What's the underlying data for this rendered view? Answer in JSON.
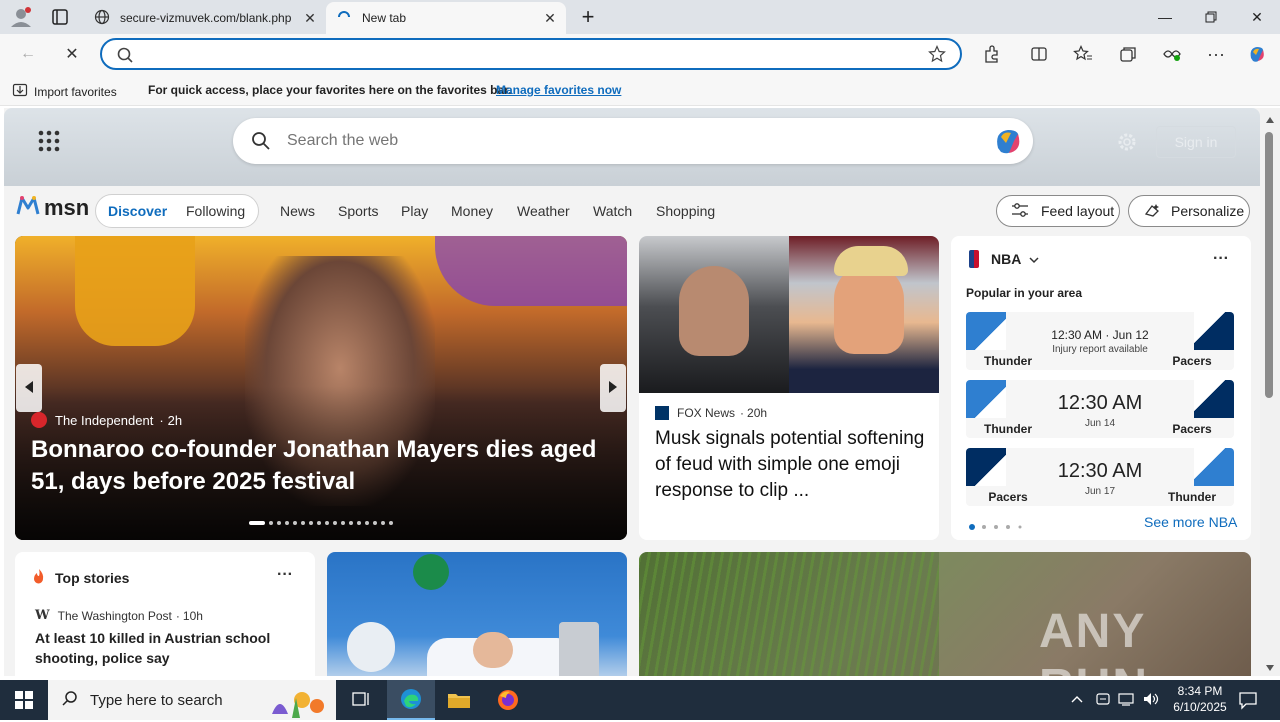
{
  "browser": {
    "tabs": [
      {
        "label": "secure-vizmuvek.com/blank.php",
        "active": false
      },
      {
        "label": "New tab",
        "active": true
      }
    ],
    "address": {
      "value": "",
      "placeholder": ""
    },
    "favorites_bar": {
      "import_label": "Import favorites",
      "message": "For quick access, place your favorites here on the favorites bar.",
      "manage_link": "Manage favorites now"
    }
  },
  "msn": {
    "search_placeholder": "Search the web",
    "signin_label": "Sign in",
    "logo_text": "msn",
    "discover_label": "Discover",
    "following_label": "Following",
    "nav": [
      "News",
      "Sports",
      "Play",
      "Money",
      "Weather",
      "Watch",
      "Shopping"
    ],
    "feed_layout_label": "Feed layout",
    "personalize_label": "Personalize"
  },
  "hero": {
    "source": "The Independent",
    "age": "2h",
    "headline": "Bonnaroo co-founder Jonathan Mayers dies aged 51, days before 2025 festival"
  },
  "story2": {
    "source": "FOX News",
    "age": "20h",
    "headline": "Musk signals potential softening of feud with simple one emoji response to clip ..."
  },
  "nba": {
    "title": "NBA",
    "subtitle": "Popular in your area",
    "games": [
      {
        "home": "Thunder",
        "away": "Pacers",
        "time": "12:30 AM · Jun 12",
        "note": "Injury report available"
      },
      {
        "home": "Thunder",
        "away": "Pacers",
        "time": "12:30 AM",
        "note": "Jun 14"
      },
      {
        "home": "Pacers",
        "away": "Thunder",
        "time": "12:30 AM",
        "note": "Jun 17"
      }
    ],
    "see_more": "See more NBA"
  },
  "top_stories": {
    "title": "Top stories",
    "source": "The Washington Post",
    "age": "10h",
    "headline": "At least 10 killed in Austrian school shooting, police say"
  },
  "taskbar": {
    "search_placeholder": "Type here to search",
    "time": "8:34 PM",
    "date": "6/10/2025"
  },
  "watermark": "ANY RUN",
  "colors": {
    "accent": "#0f6cbd",
    "thunder": "#2f7fd0",
    "pacers": "#002d62",
    "pacers_gold": "#fdbb30"
  }
}
